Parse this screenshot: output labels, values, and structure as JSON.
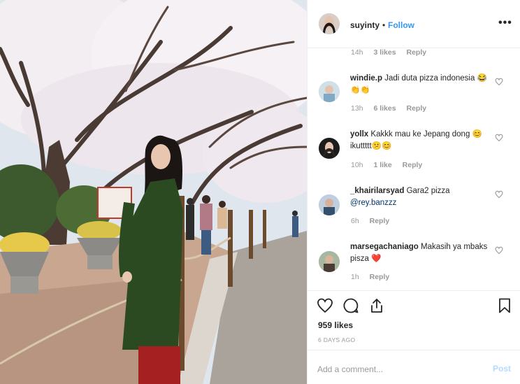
{
  "post": {
    "username": "suyinty",
    "follow_label": "Follow",
    "dot": "•",
    "more_label": "•••"
  },
  "top_meta": {
    "time": "14h",
    "likes": "3 likes",
    "reply": "Reply"
  },
  "comments": [
    {
      "username": "windie.p",
      "text": "Jadi duta pizza indonesia 😂👏👏",
      "time": "13h",
      "likes": "6 likes",
      "reply": "Reply"
    },
    {
      "username": "yollx",
      "text": "Kakkk mau ke Jepang dong 😊ikuttttt😕😊",
      "time": "10h",
      "likes": "1 like",
      "reply": "Reply"
    },
    {
      "username": "_khairilarsyad",
      "text": "Gara2 pizza",
      "mention": "@rey.banzzz",
      "time": "6h",
      "reply": "Reply"
    },
    {
      "username": "marsegachaniago",
      "text": "Makasih ya mbaks pisza ❤️",
      "time": "1h",
      "reply": "Reply"
    }
  ],
  "likes_count": "959 likes",
  "posted_date": "6 DAYS AGO",
  "add_comment": {
    "placeholder": "Add a comment...",
    "post_label": "Post"
  },
  "icons": {
    "like": "heart-icon",
    "comment": "comment-icon",
    "share": "share-icon",
    "save": "bookmark-icon",
    "more": "more-options-icon"
  },
  "colors": {
    "link_blue": "#3897f0",
    "muted": "#999999",
    "post_disabled": "#b3dbff"
  }
}
